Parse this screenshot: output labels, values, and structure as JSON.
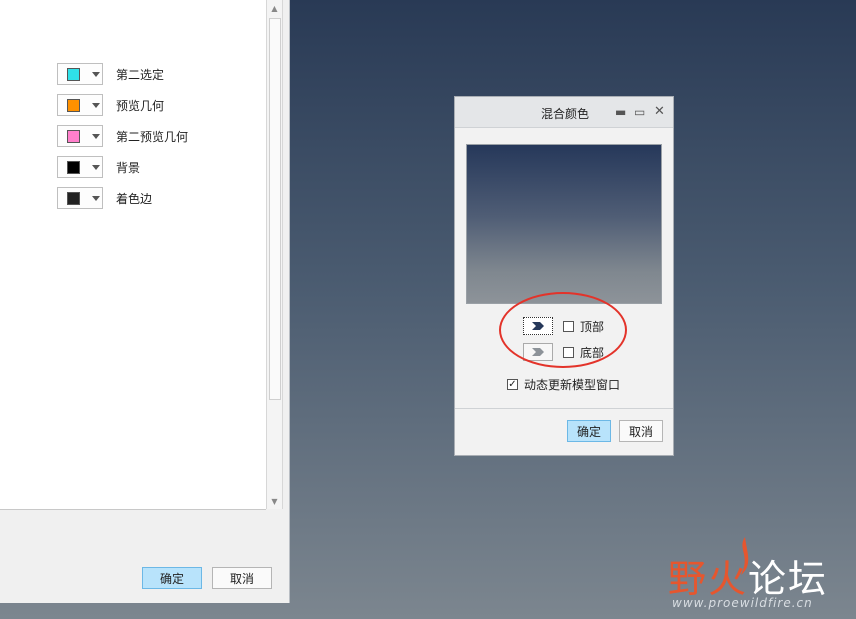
{
  "left_panel": {
    "color_rows": [
      {
        "label": "第二选定",
        "color": "#2fe1e8"
      },
      {
        "label": "预览几何",
        "color": "#ff9100"
      },
      {
        "label": "第二预览几何",
        "color": "#ff7fcb"
      },
      {
        "label": "背景",
        "color": "#000000"
      },
      {
        "label": "着色边",
        "color": "#222222"
      }
    ],
    "ok_label": "确定",
    "cancel_label": "取消"
  },
  "dialog": {
    "title": "混合颜色",
    "top_label": "顶部",
    "bottom_label": "底部",
    "dynamic_label": "动态更新模型窗口",
    "dynamic_checked": true,
    "top_checked": false,
    "bottom_checked": false,
    "ok_label": "确定",
    "cancel_label": "取消",
    "preview_top_color": "#26385a",
    "preview_bottom_color": "#8d9399"
  },
  "watermark": {
    "part1": "野火",
    "part2": "论坛",
    "url": "www.proewildfire.cn"
  },
  "colors": {
    "accent_button": "#b8e3fb",
    "annotation_red": "#e3332a"
  }
}
